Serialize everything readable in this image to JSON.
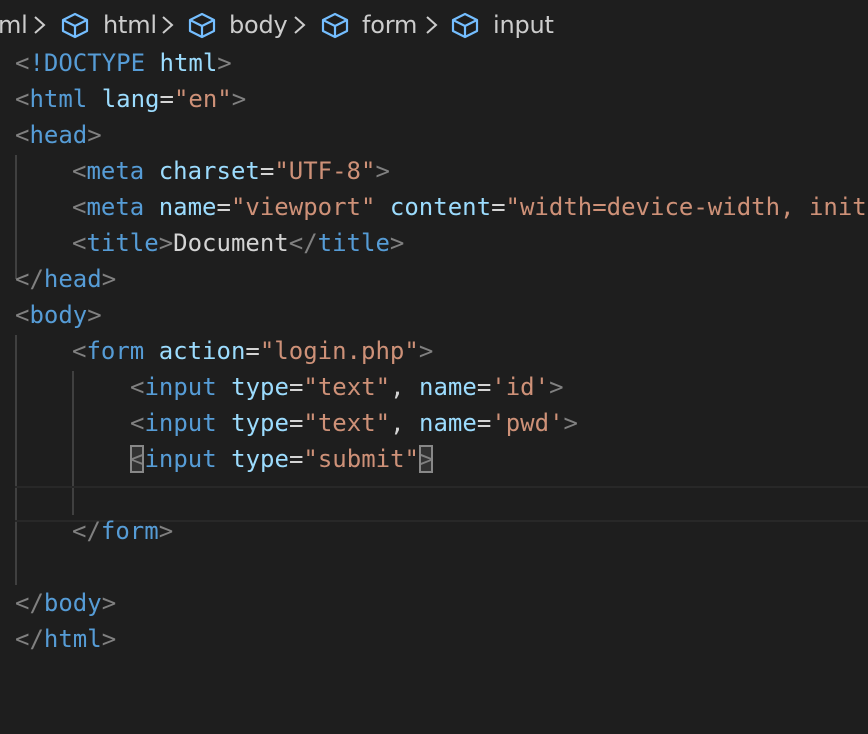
{
  "breadcrumb": {
    "items": [
      {
        "label": "ml",
        "icon": "none"
      },
      {
        "label": "html",
        "icon": "cube-icon"
      },
      {
        "label": "body",
        "icon": "cube-icon"
      },
      {
        "label": "form",
        "icon": "cube-icon"
      },
      {
        "label": "input",
        "icon": "cube-icon"
      }
    ],
    "separator_icon": "chevron-right-icon",
    "icon_color": "#75beff",
    "text_color": "#cccccc"
  },
  "editor": {
    "colors": {
      "background": "#1e1e1e",
      "tag": "#569cd6",
      "attribute": "#9cdcfe",
      "string": "#ce9178",
      "delimiter": "#808080",
      "text": "#d4d4d4"
    },
    "lines": [
      {
        "t1": "<",
        "t2": "!DOCTYPE",
        "t3": " ",
        "t4": "html",
        "t5": ">"
      },
      {
        "t1": "<",
        "t2": "html",
        "t3": " ",
        "t4": "lang",
        "t5": "=",
        "t6": "\"en\"",
        "t7": ">"
      },
      {
        "t1": "<",
        "t2": "head",
        "t3": ">"
      },
      {
        "t1": "<",
        "t2": "meta",
        "t3": " ",
        "t4": "charset",
        "t5": "=",
        "t6": "\"UTF-8\"",
        "t7": ">"
      },
      {
        "t1": "<",
        "t2": "meta",
        "t3": " ",
        "t4": "name",
        "t5": "=",
        "t6": "\"viewport\"",
        "t7": " ",
        "t8": "content",
        "t9": "=",
        "t10": "\"width=device-width, init"
      },
      {
        "t1": "<",
        "t2": "title",
        "t3": ">",
        "t4": "Document",
        "t5": "</",
        "t6": "title",
        "t7": ">"
      },
      {
        "t1": "</",
        "t2": "head",
        "t3": ">"
      },
      {
        "t1": "<",
        "t2": "body",
        "t3": ">"
      },
      {
        "t1": "<",
        "t2": "form",
        "t3": " ",
        "t4": "action",
        "t5": "=",
        "t6": "\"login.php\"",
        "t7": ">"
      },
      {
        "t1": "<",
        "t2": "input",
        "t3": " ",
        "t4": "type",
        "t5": "=",
        "t6": "\"text\"",
        "t7": ", ",
        "t8": "name",
        "t9": "=",
        "t10": "'id'",
        "t11": ">"
      },
      {
        "t1": "<",
        "t2": "input",
        "t3": " ",
        "t4": "type",
        "t5": "=",
        "t6": "\"text\"",
        "t7": ", ",
        "t8": "name",
        "t9": "=",
        "t10": "'pwd'",
        "t11": ">"
      },
      {
        "t1": "<",
        "t2": "input",
        "t3": " ",
        "t4": "type",
        "t5": "=",
        "t6": "\"submit\"",
        "t7": ">"
      },
      {
        "t1": "</",
        "t2": "form",
        "t3": ">"
      },
      {
        "t1": "</",
        "t2": "body",
        "t3": ">"
      },
      {
        "t1": "</",
        "t2": "html",
        "t3": ">"
      }
    ]
  }
}
